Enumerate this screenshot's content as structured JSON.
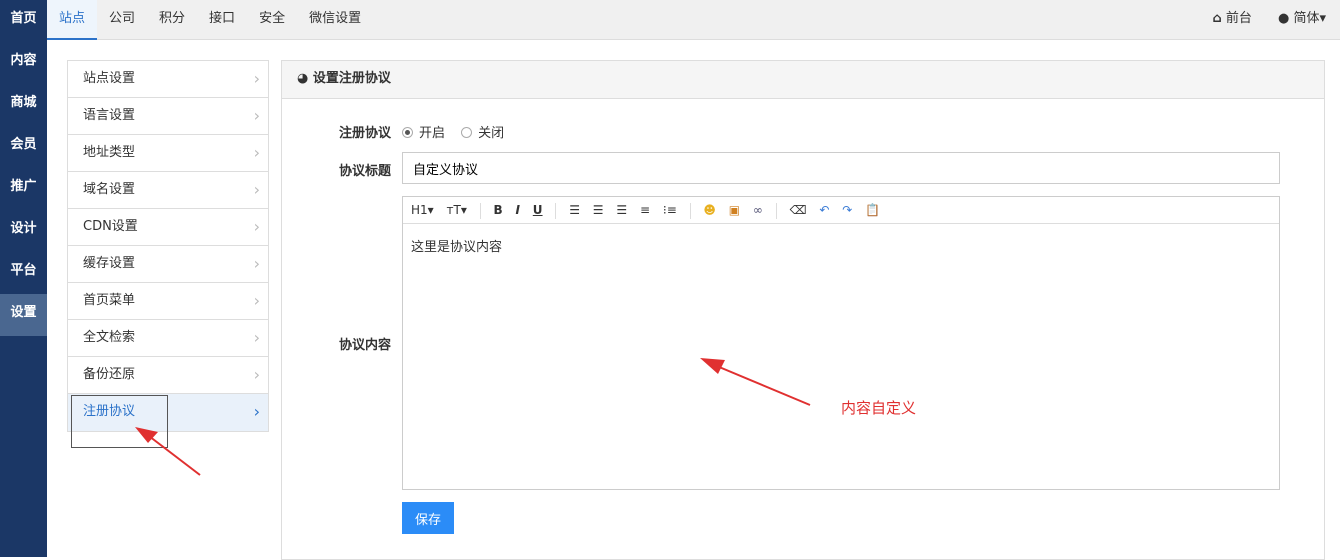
{
  "sidebar": [
    "首页",
    "内容",
    "商城",
    "会员",
    "推广",
    "设计",
    "平台",
    "设置"
  ],
  "top_tabs": [
    "站点",
    "公司",
    "积分",
    "接口",
    "安全",
    "微信设置"
  ],
  "top_right": {
    "front": "前台",
    "lang": "简体▾"
  },
  "menu": [
    "站点设置",
    "语言设置",
    "地址类型",
    "域名设置",
    "CDN设置",
    "缓存设置",
    "首页菜单",
    "全文检索",
    "备份还原",
    "注册协议"
  ],
  "panel": {
    "title": "设置注册协议",
    "agree_label": "注册协议",
    "open": "开启",
    "close": "关闭",
    "title_label": "协议标题",
    "title_value": "自定义协议",
    "content_label": "协议内容",
    "content_value": "这里是协议内容",
    "toolbar": {
      "h1": "H1▾",
      "tt": "ᴛT▾",
      "b": "B",
      "i": "I",
      "u": "U"
    },
    "save": "保存"
  },
  "annotation": "内容自定义"
}
